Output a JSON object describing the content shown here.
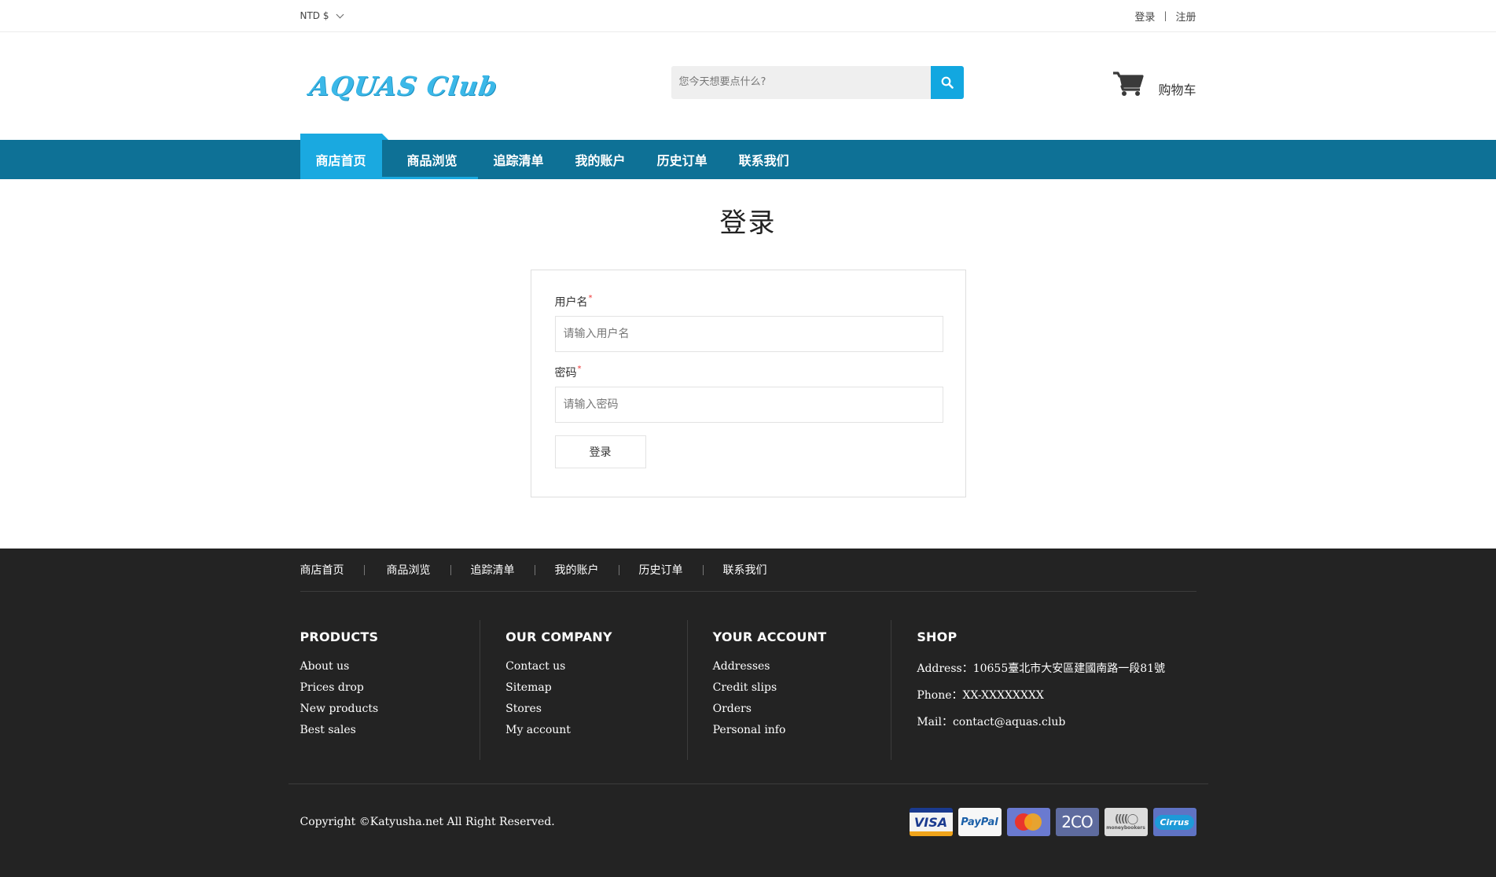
{
  "topbar": {
    "currency": "NTD $",
    "login_link": "登录",
    "separator": "|",
    "register_link": "注册"
  },
  "header": {
    "logo_text": "AQUAS Club",
    "search_placeholder": "您今天想要点什么?",
    "search_icon": "search-icon",
    "cart_icon": "cart-icon",
    "cart_label": "购物车"
  },
  "nav": {
    "items": [
      {
        "label": "商店首页",
        "active": true
      },
      {
        "label": "商品浏览",
        "active": false
      },
      {
        "label": "追踪清单",
        "active": false
      },
      {
        "label": "我的账户",
        "active": false
      },
      {
        "label": "历史订单",
        "active": false
      },
      {
        "label": "联系我们",
        "active": false
      }
    ]
  },
  "page": {
    "title": "登录",
    "form": {
      "username_label": "用户名",
      "username_placeholder": "请输入用户名",
      "password_label": "密码",
      "password_placeholder": "请输入密码",
      "required_mark": "*",
      "submit_label": "登录"
    }
  },
  "footer": {
    "nav": [
      "商店首页",
      "商品浏览",
      "追踪清单",
      "我的账户",
      "历史订单",
      "联系我们"
    ],
    "columns": {
      "products": {
        "title": "PRODUCTS",
        "links": [
          "About us",
          "Prices drop",
          "New products",
          "Best sales"
        ]
      },
      "company": {
        "title": "OUR COMPANY",
        "links": [
          "Contact us",
          "Sitemap",
          "Stores",
          "My account"
        ]
      },
      "account": {
        "title": "YOUR ACCOUNT",
        "links": [
          "Addresses",
          "Credit slips",
          "Orders",
          "Personal info"
        ]
      },
      "shop": {
        "title": "SHOP",
        "address": "Address：10655臺北市大安區建國南路一段81號",
        "phone": "Phone：XX-XXXXXXXX",
        "mail": "Mail：contact@aquas.club"
      }
    },
    "copyright": "Copyright ©Katyusha.net All Right Reserved.",
    "payments": {
      "visa": "VISA",
      "paypal": "PayPal",
      "mastercard": "MasterCard",
      "twocheckout": "2CO",
      "moneybookers": "moneybookers",
      "cirrus": "Cirrus"
    }
  },
  "colors": {
    "nav_bg": "#0e7196",
    "accent": "#1aa9e0",
    "footer_bg": "#232323"
  }
}
